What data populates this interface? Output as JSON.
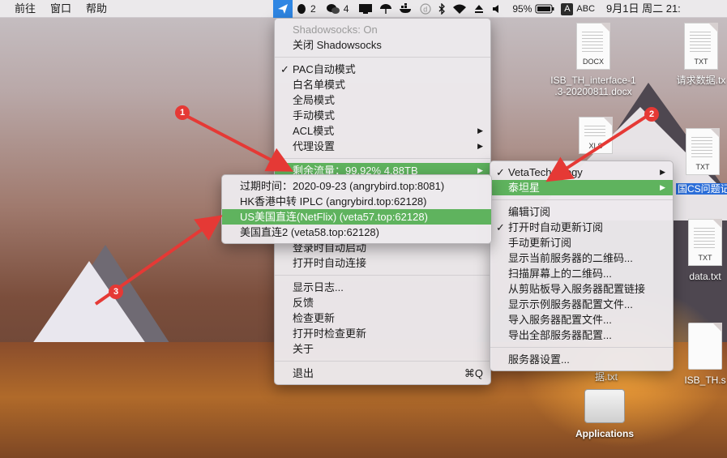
{
  "menubar": {
    "left_items": [
      "前往",
      "窗口",
      "帮助"
    ],
    "qq_count": "2",
    "wechat_count": "4",
    "battery": "95%",
    "input_source": "A",
    "input_label": "ABC",
    "datetime": "9月1日 周二  21:",
    "accent_color": "#2f86e3"
  },
  "main_menu": {
    "status": "Shadowsocks: On",
    "toggle": "关闭 Shadowsocks",
    "modes": [
      {
        "label": "PAC自动模式",
        "checked": true
      },
      {
        "label": "白名单模式",
        "checked": false
      },
      {
        "label": "全局模式",
        "checked": false
      },
      {
        "label": "手动模式",
        "checked": false
      },
      {
        "label": "ACL模式",
        "checked": false,
        "submenu": true
      },
      {
        "label": "代理设置",
        "checked": false,
        "submenu": true
      }
    ],
    "traffic": "剩余流量：99.92% 4.88TB",
    "login_start": "登录时自动启动",
    "open_connect": "打开时自动连接",
    "log": "显示日志...",
    "feedback": "反馈",
    "check_update": "检查更新",
    "check_on_open": "打开时检查更新",
    "about": "关于",
    "quit": "退出",
    "quit_shortcut": "⌘Q",
    "highlight_color": "#5fb35e"
  },
  "server_menu": {
    "items": [
      {
        "label": "过期时间：2020-09-23 (angrybird.top:8081)",
        "highlight": false
      },
      {
        "label": "HK香港中转 IPLC (angrybird.top:62128)",
        "highlight": false
      },
      {
        "label": "US美国直连(NetFlix) (veta57.top:62128)",
        "highlight": true
      },
      {
        "label": "美国直连2 (veta58.top:62128)",
        "highlight": false
      }
    ]
  },
  "sub_menu": {
    "groups": [
      {
        "label": "VetaTechnology",
        "checked": true
      },
      {
        "label": "泰坦星",
        "checked": false,
        "highlight": true
      }
    ],
    "edit_sub": "编辑订阅",
    "auto_update": "打开时自动更新订阅",
    "manual_update": "手动更新订阅",
    "show_qr": "显示当前服务器的二维码...",
    "scan_qr": "扫描屏幕上的二维码...",
    "import_clip": "从剪贴板导入服务器配置链接",
    "show_example": "显示示例服务器配置文件...",
    "import_file": "导入服务器配置文件...",
    "export_all": "导出全部服务器配置...",
    "server_settings": "服务器设置..."
  },
  "desktop": {
    "files": [
      {
        "ext": "DOCX",
        "label1": "ISB_TH_interface-1",
        "label2": ".3-20200811.docx"
      },
      {
        "ext": "TXT",
        "label1": "请求数据.tx",
        "label2": ""
      },
      {
        "ext": "XLS",
        "label1": "",
        "label2": ""
      },
      {
        "ext": "TXT",
        "label1": "国CS问题记",
        "label2": ""
      },
      {
        "ext": "TXT",
        "label1": "data.txt",
        "label2": ""
      },
      {
        "ext": "",
        "label1": "ISB_TH.s",
        "label2": ""
      },
      {
        "ext": "",
        "label1": "据.txt",
        "label2": ""
      },
      {
        "ext": "",
        "label1": "Applications",
        "label2": ""
      }
    ]
  },
  "annotations": {
    "badges": [
      "1",
      "2",
      "3"
    ],
    "color": "#e53935"
  }
}
